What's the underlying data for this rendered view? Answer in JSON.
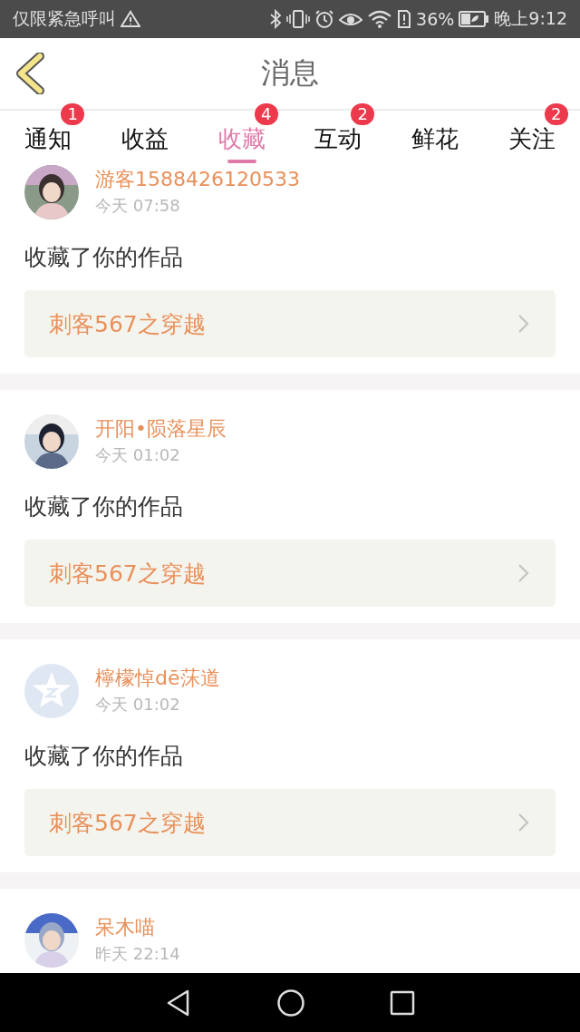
{
  "status_bar": {
    "carrier": "仅限紧急呼叫",
    "battery_percent": "36%",
    "time": "晚上9:12"
  },
  "header": {
    "title": "消息"
  },
  "tabs": [
    {
      "label": "通知",
      "badge": "1",
      "selected": false
    },
    {
      "label": "收益",
      "selected": false
    },
    {
      "label": "收藏",
      "badge": "4",
      "selected": true
    },
    {
      "label": "互动",
      "badge": "2",
      "selected": false
    },
    {
      "label": "鲜花",
      "selected": false
    },
    {
      "label": "关注",
      "badge": "2",
      "selected": false
    }
  ],
  "messages": [
    {
      "user": "游客1588426120533",
      "time": "今天 07:58",
      "action": "收藏了你的作品",
      "work": "刺客567之穿越"
    },
    {
      "user": "开阳•陨落星辰",
      "time": "今天 01:02",
      "action": "收藏了你的作品",
      "work": "刺客567之穿越"
    },
    {
      "avatar": {
        "kind": "icon"
      },
      "user": "檸檬悼dē莯道",
      "time": "今天 01:02",
      "action": "收藏了你的作品",
      "work": "刺客567之穿越"
    },
    {
      "user": "呆木喵",
      "time": "昨天 22:14"
    }
  ]
}
